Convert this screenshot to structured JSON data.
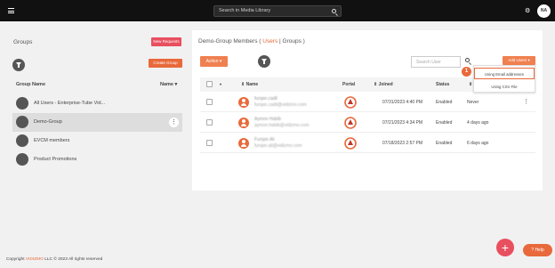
{
  "topbar": {
    "search_placeholder": "Search in Media Library",
    "avatar_initials": "NA"
  },
  "left": {
    "title": "Groups",
    "new_requests": "New Requests",
    "create_group": "Create Group",
    "col_group_name": "Group Name",
    "col_name_sort": "Name ▾",
    "groups": [
      {
        "label": "All Users - Enterprise-Tube Vid..."
      },
      {
        "label": "Demo-Group"
      },
      {
        "label": "EVCM members"
      },
      {
        "label": "Product Promotions"
      }
    ]
  },
  "panel": {
    "title_prefix": "Demo-Group Members ( ",
    "title_users": "Users",
    "title_sep": " | Groups )",
    "action": "Action ▾",
    "search_placeholder": "Search User",
    "add_users": "Add Users ▾",
    "dropdown": [
      "Using Email addresses",
      "Using CSV File"
    ],
    "step_number": "1",
    "columns": [
      "Name",
      "Portal",
      "Joined",
      "Status"
    ],
    "rows": [
      {
        "name": "furqan.cadil",
        "email": "furqan.cadil@vidizmo.com",
        "joined": "07/31/2023 4:40 PM",
        "status": "Enabled",
        "last": "Never"
      },
      {
        "name": "Aymon Habib",
        "email": "aymon.habib@vidizmo.com",
        "joined": "07/21/2023 4:34 PM",
        "status": "Enabled",
        "last": "4 days ago"
      },
      {
        "name": "Furqan Ali",
        "email": "furqan.ali@vidizmo.com",
        "joined": "07/18/2023 2:57 PM",
        "status": "Enabled",
        "last": "6 days ago"
      }
    ]
  },
  "footer": {
    "prefix": "Copyright ",
    "brand": "VIDIZMO",
    "suffix": " LLC © 2023 All rights reserved"
  },
  "help": "Help",
  "colors": {
    "accent": "#e8693b",
    "danger": "#e84f5f",
    "topbar": "#111111"
  }
}
